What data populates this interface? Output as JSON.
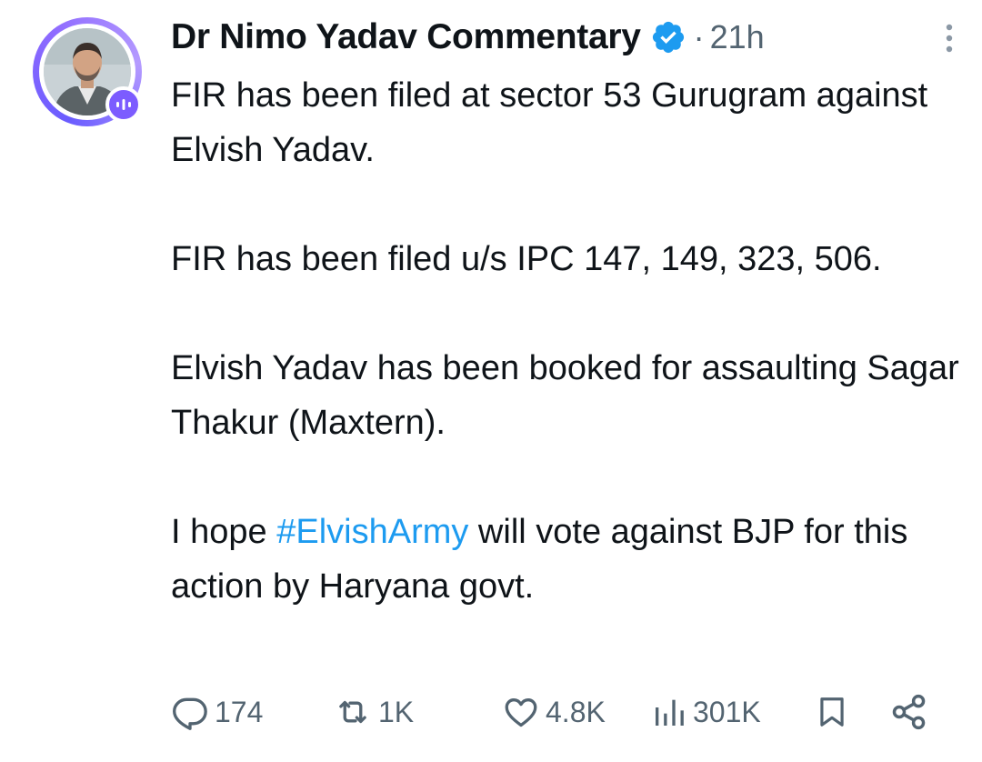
{
  "author": {
    "display_name": "Dr Nimo Yadav Commentary",
    "verified": true,
    "separator": "·",
    "timestamp": "21h"
  },
  "tweet": {
    "para1": "FIR has been filed at sector 53 Gurugram against Elvish Yadav.",
    "para2": "FIR has been filed u/s IPC 147, 149, 323, 506.",
    "para3": "Elvish Yadav has been booked for assaulting Sagar Thakur (Maxtern).",
    "para4_before": "I hope ",
    "para4_hashtag": "#ElvishArmy",
    "para4_after": " will vote against BJP for this action by Haryana govt."
  },
  "actions": {
    "replies": "174",
    "reposts": "1K",
    "likes": "4.8K",
    "views": "301K"
  },
  "icons": {
    "verified": "verified-badge-icon",
    "more": "more-vertical-icon",
    "reply": "reply-icon",
    "repost": "repost-icon",
    "like": "heart-icon",
    "views": "views-chart-icon",
    "bookmark": "bookmark-icon",
    "share": "share-icon",
    "avatar_badge": "spaces-live-icon"
  },
  "colors": {
    "text": "#0f1419",
    "secondary": "#536471",
    "link": "#1d9bf0",
    "verified": "#1d9bf0",
    "ring": "#7c5cff"
  }
}
